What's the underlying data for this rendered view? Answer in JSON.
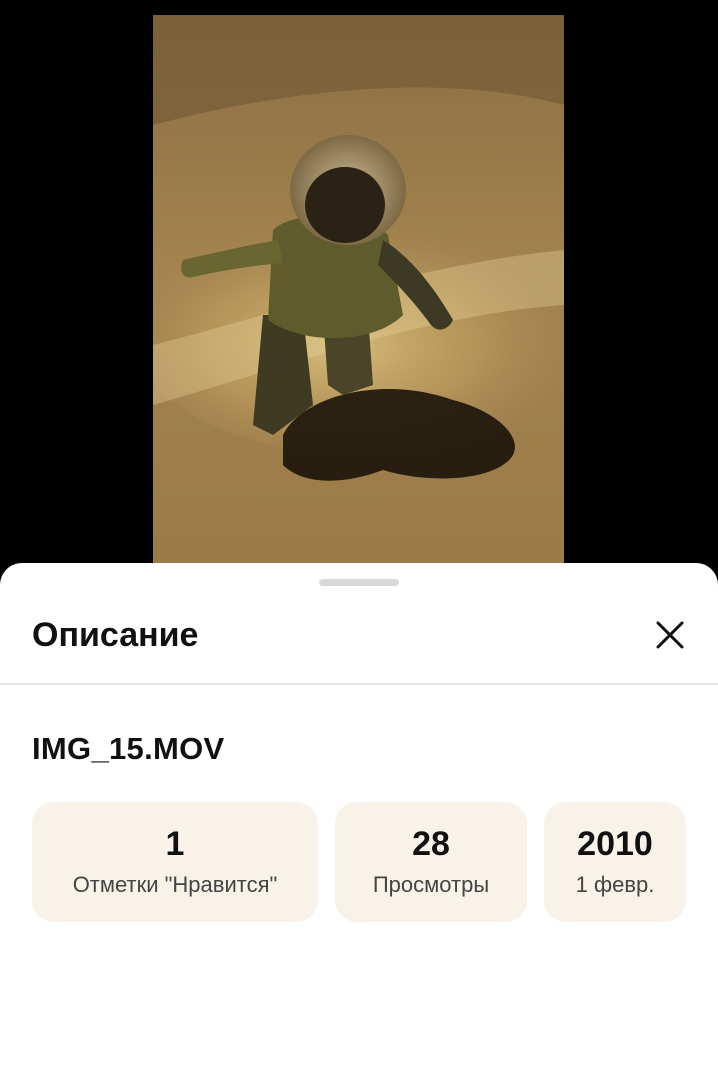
{
  "video": {
    "description": "child in winter snowsuit standing on snow at night"
  },
  "sheet": {
    "title": "Описание",
    "close_icon": "close-icon",
    "file_name": "IMG_15.MOV",
    "stats": [
      {
        "value": "1",
        "caption": "Отметки \"Нравится\""
      },
      {
        "value": "28",
        "caption": "Просмотры"
      },
      {
        "value": "2010",
        "caption": "1 февр."
      }
    ]
  },
  "colors": {
    "card_background": "#f8f2e8",
    "sheet_background": "#ffffff",
    "backdrop": "#000000"
  }
}
